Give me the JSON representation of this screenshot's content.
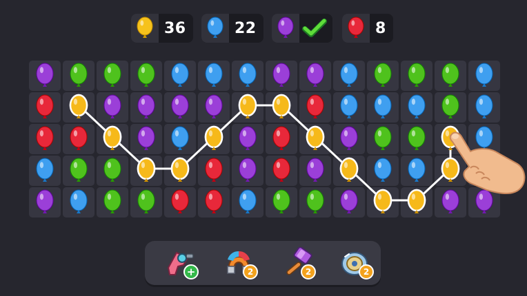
{
  "goals": [
    {
      "color": "#f6c21c",
      "value": "36",
      "done": false
    },
    {
      "color": "#3f9ff0",
      "value": "22",
      "done": false
    },
    {
      "color": "#9b3fd8",
      "value": "",
      "done": true
    },
    {
      "color": "#e8283a",
      "value": "8",
      "done": false
    }
  ],
  "colors": {
    "P": "#9b3fd8",
    "G": "#4fc21d",
    "B": "#3f9ff0",
    "R": "#e8283a",
    "Y": "#f6b91a"
  },
  "grid": [
    [
      "P",
      "G",
      "G",
      "G",
      "B",
      "B",
      "B",
      "P",
      "P",
      "B",
      "G",
      "G",
      "G",
      "B"
    ],
    [
      "R",
      "Y",
      "P",
      "P",
      "P",
      "P",
      "Y",
      "Y",
      "R",
      "B",
      "B",
      "B",
      "G",
      "B"
    ],
    [
      "R",
      "R",
      "Y",
      "P",
      "B",
      "Y",
      "P",
      "R",
      "Y",
      "P",
      "G",
      "G",
      "Y",
      "B"
    ],
    [
      "B",
      "G",
      "G",
      "Y",
      "Y",
      "R",
      "P",
      "R",
      "P",
      "Y",
      "B",
      "B",
      "Y",
      "P"
    ],
    [
      "P",
      "B",
      "G",
      "G",
      "R",
      "R",
      "B",
      "G",
      "G",
      "P",
      "Y",
      "Y",
      "P",
      "P"
    ]
  ],
  "path": [
    [
      1,
      1
    ],
    [
      2,
      2
    ],
    [
      3,
      3
    ],
    [
      3,
      4
    ],
    [
      2,
      5
    ],
    [
      1,
      6
    ],
    [
      1,
      7
    ],
    [
      2,
      8
    ],
    [
      3,
      9
    ],
    [
      4,
      10
    ],
    [
      4,
      11
    ],
    [
      3,
      12
    ],
    [
      2,
      12
    ]
  ],
  "path_color": "#ffffff",
  "boosters": [
    {
      "name": "blaster",
      "badge": "+"
    },
    {
      "name": "magnet",
      "badge": "2"
    },
    {
      "name": "hammer",
      "badge": "2"
    },
    {
      "name": "spinner",
      "badge": "2"
    }
  ]
}
